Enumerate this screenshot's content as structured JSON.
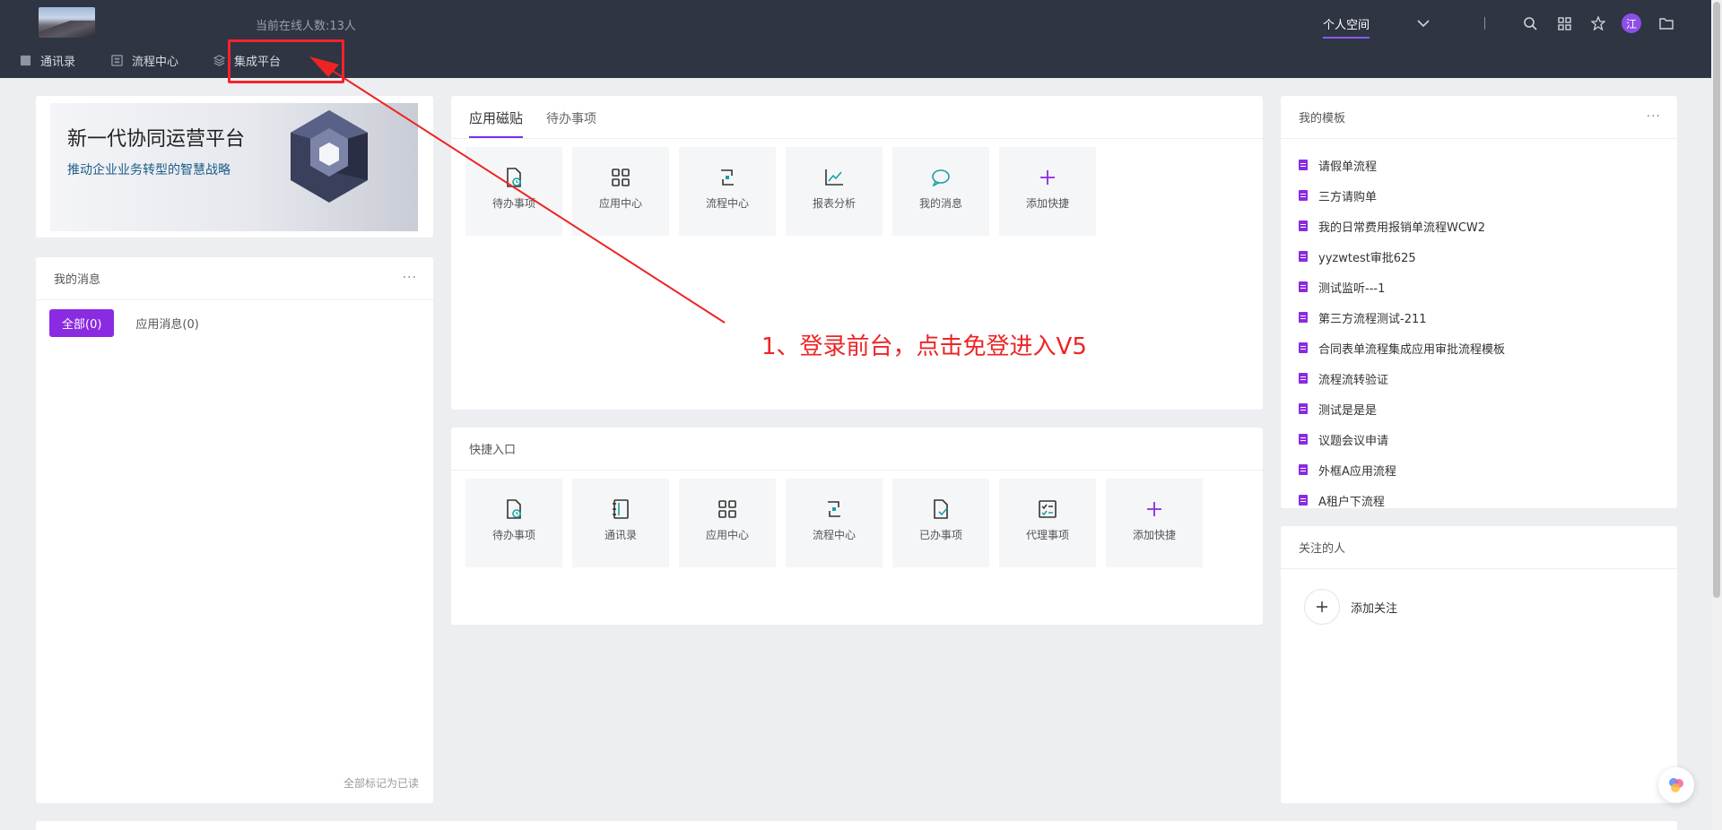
{
  "header": {
    "online_text": "当前在线人数:13人",
    "nav": [
      {
        "label": "通讯录",
        "icon": "contacts-icon"
      },
      {
        "label": "流程中心",
        "icon": "flow-icon"
      },
      {
        "label": "集成平台",
        "icon": "layers-icon"
      }
    ],
    "personal_space": "个人空间",
    "avatar_text": "江",
    "icons": [
      "chevron-down-icon",
      "search-icon",
      "grid-icon",
      "star-icon",
      "folder-icon"
    ]
  },
  "banner": {
    "title": "新一代协同运营平台",
    "subtitle": "推动企业业务转型的智慧战略"
  },
  "messages": {
    "title": "我的消息",
    "tab_all": "全部(0)",
    "tab_app": "应用消息(0)",
    "mark_read": "全部标记为已读"
  },
  "app_panel": {
    "tabs": [
      "应用磁贴",
      "待办事项"
    ],
    "tiles": [
      {
        "label": "待办事项",
        "icon": "todo-icon"
      },
      {
        "label": "应用中心",
        "icon": "apps-icon"
      },
      {
        "label": "流程中心",
        "icon": "flow-icon"
      },
      {
        "label": "报表分析",
        "icon": "chart-icon"
      },
      {
        "label": "我的消息",
        "icon": "chat-icon"
      },
      {
        "label": "添加快捷",
        "icon": "plus-icon"
      }
    ]
  },
  "quick_panel": {
    "title": "快捷入口",
    "tiles": [
      {
        "label": "待办事项",
        "icon": "todo-icon"
      },
      {
        "label": "通讯录",
        "icon": "contacts-book-icon"
      },
      {
        "label": "应用中心",
        "icon": "apps-icon"
      },
      {
        "label": "流程中心",
        "icon": "flow-icon"
      },
      {
        "label": "已办事项",
        "icon": "done-icon"
      },
      {
        "label": "代理事项",
        "icon": "checklist-icon"
      },
      {
        "label": "添加快捷",
        "icon": "plus-icon"
      }
    ]
  },
  "templates": {
    "title": "我的模板",
    "items": [
      "请假单流程",
      "三方请购单",
      "我的日常费用报销单流程WCW2",
      "yyzwtest审批625",
      "测试监听---1",
      "第三方流程测试-211",
      "合同表单流程集成应用审批流程模板",
      "流程流转验证",
      "测试是是是",
      "议题会议申请",
      "外框A应用流程",
      "A租户下流程"
    ]
  },
  "follow": {
    "title": "关注的人",
    "add_label": "添加关注"
  },
  "annotation": {
    "text": "1、登录前台，点击免登进入V5",
    "color": "#ee2424"
  },
  "colors": {
    "topbar": "#2f3542",
    "accent": "#8a2be2",
    "highlight": "#f5222d"
  }
}
